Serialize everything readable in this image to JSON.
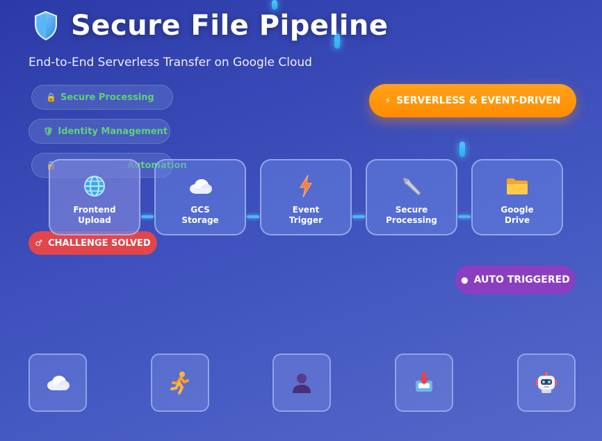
{
  "header": {
    "title": "Secure File Pipeline",
    "subtitle": "End-to-End Serverless Transfer on Google Cloud",
    "icon": "shield-icon"
  },
  "features": [
    {
      "label": "Secure Processing",
      "icon": "lock-icon"
    },
    {
      "label": "Identity Management",
      "icon": "shield-icon"
    },
    {
      "label": "Automation",
      "icon": "lock-icon"
    }
  ],
  "badges": {
    "serverless": {
      "label": "SERVERLESS & EVENT-DRIVEN",
      "icon": "lightning-icon",
      "color": "#ff9500"
    },
    "challenge": {
      "label": "CHALLENGE SOLVED",
      "icon": "mars-icon",
      "color": "#e2454a"
    },
    "auto": {
      "label": "AUTO TRIGGERED",
      "icon": "dot-icon",
      "color": "#8a3ec0"
    }
  },
  "pipeline": [
    {
      "label": "Frontend\nUpload",
      "icon": "globe-icon"
    },
    {
      "label": "GCS\nStorage",
      "icon": "cloud-icon"
    },
    {
      "label": "Event\nTrigger",
      "icon": "lightning-icon"
    },
    {
      "label": "Secure\nProcessing",
      "icon": "wrench-icon"
    },
    {
      "label": "Google\nDrive",
      "icon": "folder-icon"
    }
  ],
  "tiles": [
    {
      "icon": "cloud-icon"
    },
    {
      "icon": "runner-icon"
    },
    {
      "icon": "person-icon"
    },
    {
      "icon": "inbox-download-icon"
    },
    {
      "icon": "robot-icon"
    }
  ]
}
